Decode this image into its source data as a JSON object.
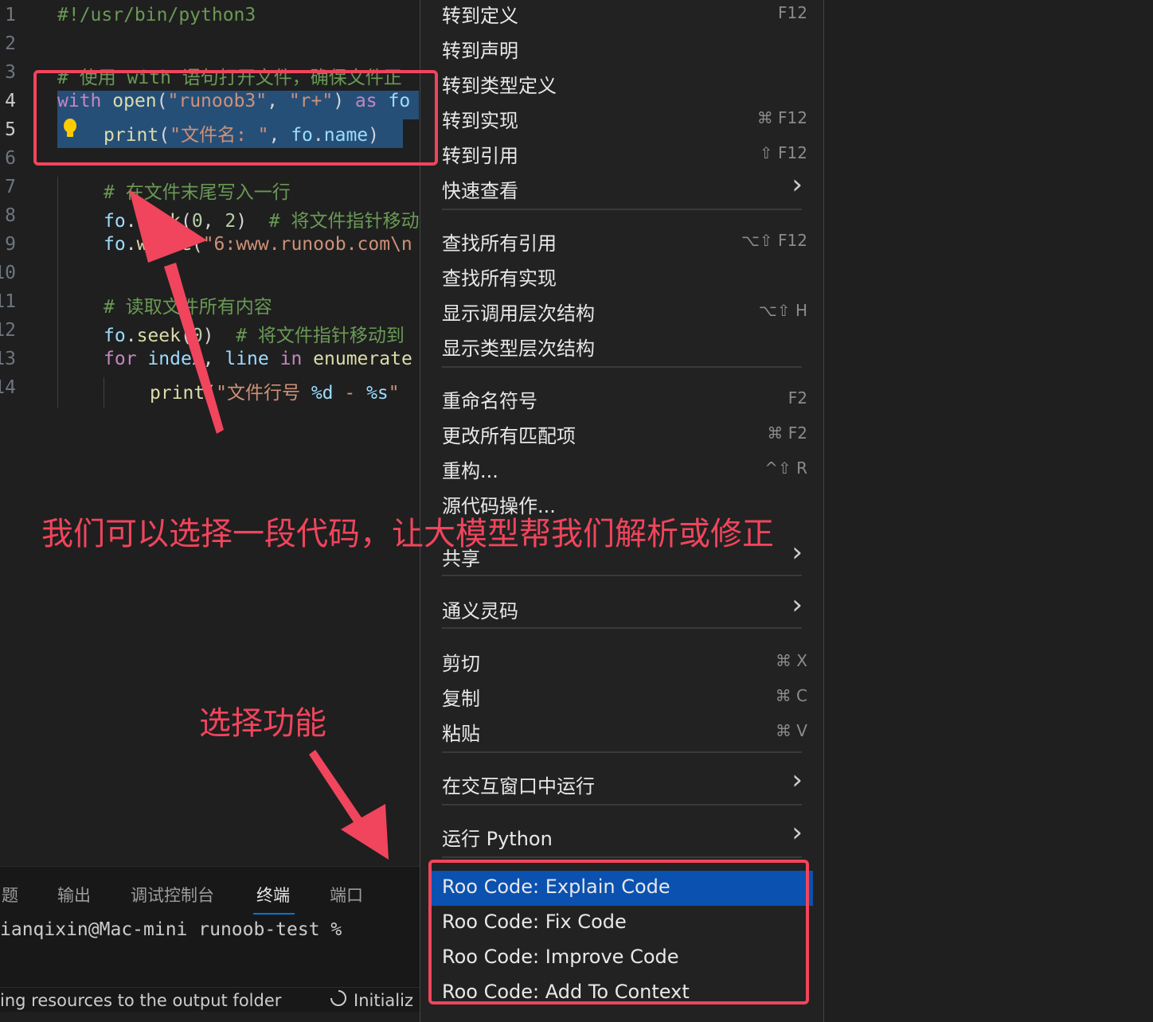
{
  "editor": {
    "lines": [
      {
        "num": "1",
        "tokens": [
          {
            "t": "#!/usr/bin/python3",
            "c": "c-com"
          }
        ]
      },
      {
        "num": "2",
        "tokens": []
      },
      {
        "num": "3",
        "tokens": [
          {
            "t": "# 使用 with 语句打开文件，确保文件正",
            "c": "c-com"
          }
        ]
      },
      {
        "num": "4",
        "tokens": [
          {
            "t": "with",
            "c": "c-kw"
          },
          {
            "t": " ",
            "c": "c-pun"
          },
          {
            "t": "open",
            "c": "c-fn"
          },
          {
            "t": "(",
            "c": "c-pun"
          },
          {
            "t": "\"runoob3\"",
            "c": "c-str"
          },
          {
            "t": ", ",
            "c": "c-pun"
          },
          {
            "t": "\"r+\"",
            "c": "c-str"
          },
          {
            "t": ") ",
            "c": "c-pun"
          },
          {
            "t": "as",
            "c": "c-kw"
          },
          {
            "t": " fo",
            "c": "c-var"
          }
        ]
      },
      {
        "num": "5",
        "tokens": [
          {
            "t": "print",
            "c": "c-fn"
          },
          {
            "t": "(",
            "c": "c-pun"
          },
          {
            "t": "\"文件名: \"",
            "c": "c-str"
          },
          {
            "t": ", ",
            "c": "c-pun"
          },
          {
            "t": "fo",
            "c": "c-var"
          },
          {
            "t": ".",
            "c": "c-pun"
          },
          {
            "t": "name",
            "c": "c-var"
          },
          {
            "t": ")",
            "c": "c-pun"
          }
        ]
      },
      {
        "num": "6",
        "tokens": []
      },
      {
        "num": "7",
        "tokens": [
          {
            "t": "# 在文件末尾写入一行",
            "c": "c-com"
          }
        ]
      },
      {
        "num": "8",
        "tokens": [
          {
            "t": "fo",
            "c": "c-var"
          },
          {
            "t": ".",
            "c": "c-pun"
          },
          {
            "t": "seek",
            "c": "c-fn"
          },
          {
            "t": "(",
            "c": "c-pun"
          },
          {
            "t": "0",
            "c": "c-num"
          },
          {
            "t": ", ",
            "c": "c-pun"
          },
          {
            "t": "2",
            "c": "c-num"
          },
          {
            "t": ")  ",
            "c": "c-pun"
          },
          {
            "t": "# 将文件指针移动",
            "c": "c-com"
          }
        ]
      },
      {
        "num": "9",
        "tokens": [
          {
            "t": "fo",
            "c": "c-var"
          },
          {
            "t": ".",
            "c": "c-pun"
          },
          {
            "t": "write",
            "c": "c-fn"
          },
          {
            "t": "(",
            "c": "c-pun"
          },
          {
            "t": "\"6:www.runoob.com\\n",
            "c": "c-str"
          }
        ]
      },
      {
        "num": "10",
        "tokens": []
      },
      {
        "num": "11",
        "tokens": [
          {
            "t": "# 读取文件所有内容",
            "c": "c-com"
          }
        ]
      },
      {
        "num": "12",
        "tokens": [
          {
            "t": "fo",
            "c": "c-var"
          },
          {
            "t": ".",
            "c": "c-pun"
          },
          {
            "t": "seek",
            "c": "c-fn"
          },
          {
            "t": "(",
            "c": "c-pun"
          },
          {
            "t": "0",
            "c": "c-num"
          },
          {
            "t": ")  ",
            "c": "c-pun"
          },
          {
            "t": "# 将文件指针移动到",
            "c": "c-com"
          }
        ]
      },
      {
        "num": "13",
        "tokens": [
          {
            "t": "for",
            "c": "c-kw"
          },
          {
            "t": " ",
            "c": "c-pun"
          },
          {
            "t": "index",
            "c": "c-var"
          },
          {
            "t": ", ",
            "c": "c-pun"
          },
          {
            "t": "line",
            "c": "c-var"
          },
          {
            "t": " ",
            "c": "c-pun"
          },
          {
            "t": "in",
            "c": "c-kw"
          },
          {
            "t": " ",
            "c": "c-pun"
          },
          {
            "t": "enumerate",
            "c": "c-fn"
          }
        ]
      },
      {
        "num": "14",
        "tokens": [
          {
            "t": "print",
            "c": "c-fn"
          },
          {
            "t": "(",
            "c": "c-pun"
          },
          {
            "t": "\"文件行号 ",
            "c": "c-str"
          },
          {
            "t": "%d",
            "c": "c-var"
          },
          {
            "t": " - ",
            "c": "c-str"
          },
          {
            "t": "%s",
            "c": "c-var"
          },
          {
            "t": "\"",
            "c": "c-str"
          }
        ]
      }
    ]
  },
  "panel": {
    "tabs": [
      "题",
      "输出",
      "调试控制台",
      "终端",
      "端口"
    ],
    "active_tab": "终端",
    "terminal_prompt": "ianqixin@Mac-mini runoob-test %"
  },
  "status": {
    "left_text": "ing resources to the output folder",
    "right_text": "Initializ"
  },
  "menu": {
    "items": [
      {
        "label": "转到定义",
        "key": "F12"
      },
      {
        "label": "转到声明",
        "key": ""
      },
      {
        "label": "转到类型定义",
        "key": ""
      },
      {
        "label": "转到实现",
        "key": "⌘ F12"
      },
      {
        "label": "转到引用",
        "key": "⇧ F12"
      },
      {
        "label": "快速查看",
        "submenu": true
      },
      {
        "label": "查找所有引用",
        "key": "⌥⇧ F12"
      },
      {
        "label": "查找所有实现",
        "key": ""
      },
      {
        "label": "显示调用层次结构",
        "key": "⌥⇧ H"
      },
      {
        "label": "显示类型层次结构",
        "key": ""
      },
      {
        "label": "重命名符号",
        "key": "F2"
      },
      {
        "label": "更改所有匹配项",
        "key": "⌘ F2"
      },
      {
        "label": "重构...",
        "key": "^⇧ R"
      },
      {
        "label": "源代码操作...",
        "key": ""
      },
      {
        "label": "共享",
        "submenu": true
      },
      {
        "label": "通义灵码",
        "submenu": true
      },
      {
        "label": "剪切",
        "key": "⌘ X"
      },
      {
        "label": "复制",
        "key": "⌘ C"
      },
      {
        "label": "粘贴",
        "key": "⌘ V"
      },
      {
        "label": "在交互窗口中运行",
        "submenu": true
      },
      {
        "label": "运行 Python",
        "submenu": true
      },
      {
        "label": "Roo Code: Explain Code",
        "highlighted": true
      },
      {
        "label": "Roo Code: Fix Code"
      },
      {
        "label": "Roo Code: Improve Code"
      },
      {
        "label": "Roo Code: Add To Context"
      }
    ]
  },
  "annotations": {
    "select_code_text": "我们可以选择一段代码，让大模型帮我们解析或修正",
    "select_function_text": "选择功能",
    "accent_color": "#f0455c"
  }
}
